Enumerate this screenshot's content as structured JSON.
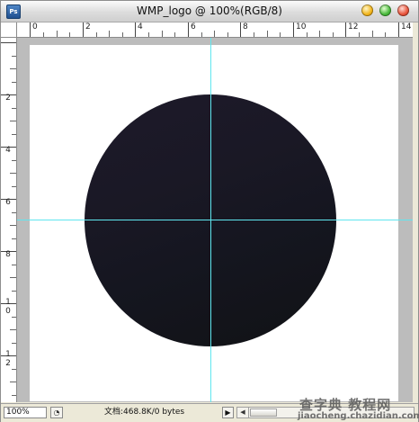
{
  "window": {
    "title": "WMP_logo @ 100%(RGB/8)",
    "app_icon_label": "Ps"
  },
  "rulers": {
    "top_labels": [
      "0",
      "2",
      "4",
      "6",
      "8",
      "10",
      "12",
      "14"
    ],
    "left_labels": [
      "2",
      "4",
      "6",
      "8",
      "1\n0",
      "1\n2"
    ]
  },
  "canvas": {
    "shape_colors": [
      "#1d1a2a",
      "#111215"
    ],
    "guide_color": "#5fe6ef"
  },
  "statusbar": {
    "zoom": "100%",
    "doc_info": "文档:468.8K/0 bytes",
    "arrow": "▶"
  },
  "watermark": {
    "top": "查字典 教程网",
    "bottom": "jiaocheng.chazidian.com"
  }
}
